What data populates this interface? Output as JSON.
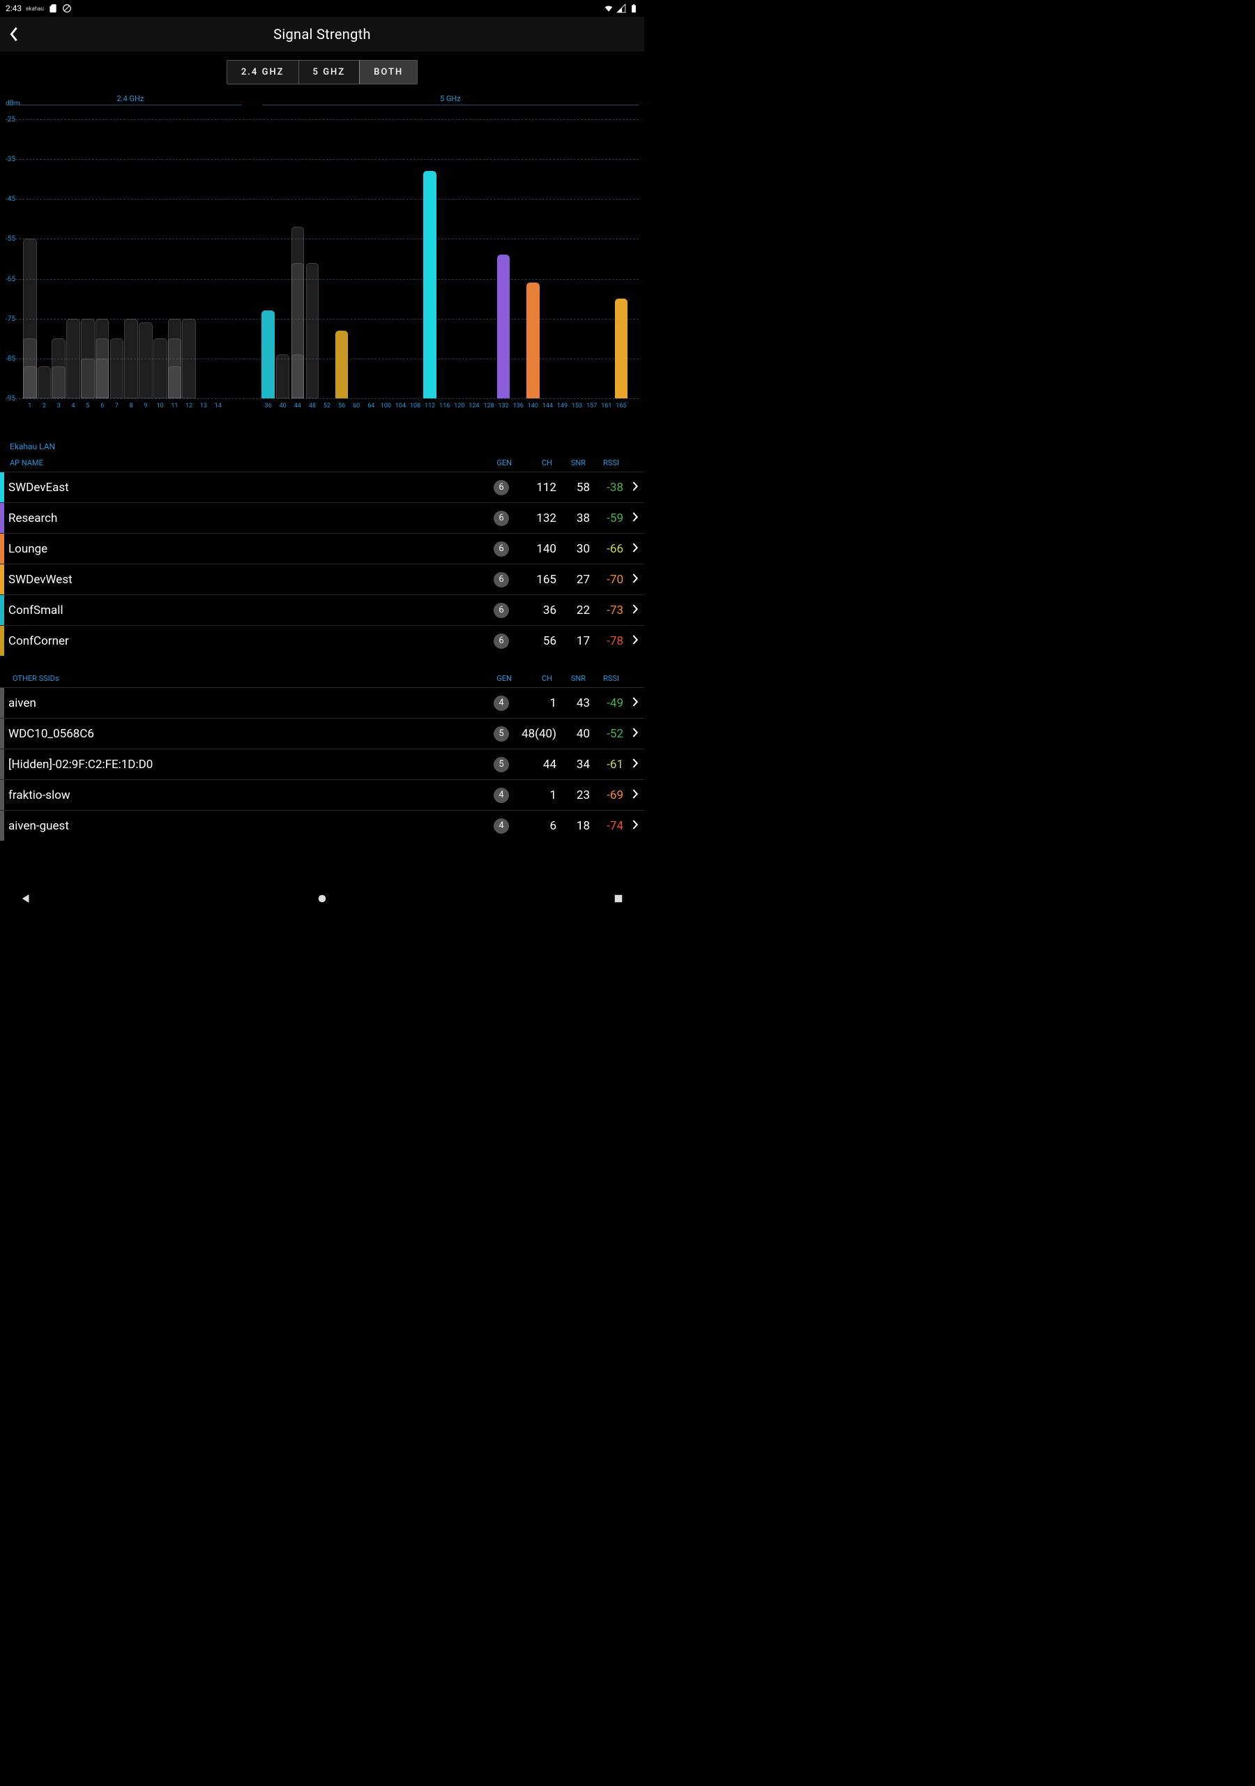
{
  "status": {
    "time": "2:43",
    "app_label": "ekahau"
  },
  "header": {
    "title": "Signal Strength"
  },
  "segments": {
    "a": "2.4 GHZ",
    "b": "5 GHZ",
    "c": "BOTH",
    "active": "c"
  },
  "chart_data": {
    "type": "bar",
    "ylabel": "dBm",
    "bands": {
      "a": "2.4 GHz",
      "b": "5 GHz"
    },
    "ylim": [
      -95,
      -25
    ],
    "yticks": [
      -25,
      -35,
      -45,
      -55,
      -65,
      -75,
      -85,
      -95
    ],
    "channels_24": [
      1,
      2,
      3,
      4,
      5,
      6,
      7,
      8,
      9,
      10,
      11,
      12,
      13,
      14
    ],
    "channels_5": [
      36,
      40,
      44,
      48,
      52,
      56,
      60,
      64,
      100,
      104,
      108,
      112,
      116,
      120,
      124,
      128,
      132,
      136,
      140,
      144,
      149,
      153,
      157,
      161,
      165
    ],
    "ghost_bars": [
      {
        "ch": 1,
        "v": -55,
        "band": "24"
      },
      {
        "ch": 1,
        "v": -80,
        "band": "24"
      },
      {
        "ch": 1,
        "v": -87,
        "band": "24"
      },
      {
        "ch": 2,
        "v": -87,
        "band": "24"
      },
      {
        "ch": 3,
        "v": -87,
        "band": "24"
      },
      {
        "ch": 3,
        "v": -80,
        "band": "24"
      },
      {
        "ch": 4,
        "v": -75,
        "band": "24"
      },
      {
        "ch": 5,
        "v": -75,
        "band": "24"
      },
      {
        "ch": 5,
        "v": -85,
        "band": "24"
      },
      {
        "ch": 6,
        "v": -75,
        "band": "24"
      },
      {
        "ch": 6,
        "v": -80,
        "band": "24"
      },
      {
        "ch": 6,
        "v": -85,
        "band": "24"
      },
      {
        "ch": 7,
        "v": -80,
        "band": "24"
      },
      {
        "ch": 8,
        "v": -75,
        "band": "24"
      },
      {
        "ch": 9,
        "v": -76,
        "band": "24"
      },
      {
        "ch": 10,
        "v": -80,
        "band": "24"
      },
      {
        "ch": 11,
        "v": -75,
        "band": "24"
      },
      {
        "ch": 11,
        "v": -80,
        "band": "24"
      },
      {
        "ch": 11,
        "v": -87,
        "band": "24"
      },
      {
        "ch": 12,
        "v": -75,
        "band": "24"
      },
      {
        "ch": 40,
        "v": -84,
        "band": "5"
      },
      {
        "ch": 44,
        "v": -52,
        "band": "5"
      },
      {
        "ch": 44,
        "v": -61,
        "band": "5"
      },
      {
        "ch": 44,
        "v": -84,
        "band": "5"
      },
      {
        "ch": 48,
        "v": -61,
        "band": "5"
      }
    ],
    "series": [
      {
        "name": "ConfSmall",
        "color": "#1fb8c9",
        "ch": 36,
        "v": -73,
        "band": "5"
      },
      {
        "name": "ConfCorner",
        "color": "#c99a1f",
        "ch": 56,
        "v": -78,
        "band": "5"
      },
      {
        "name": "SWDevEast",
        "color": "#1fd3e0",
        "ch": 112,
        "v": -38,
        "band": "5"
      },
      {
        "name": "Research",
        "color": "#8a5ed8",
        "ch": 132,
        "v": -59,
        "band": "5"
      },
      {
        "name": "Lounge",
        "color": "#e8803a",
        "ch": 140,
        "v": -66,
        "band": "5"
      },
      {
        "name": "SWDevWest",
        "color": "#e8a52a",
        "ch": 165,
        "v": -70,
        "band": "5"
      }
    ]
  },
  "ekahau_section": "Ekahau LAN",
  "headers": {
    "ap": "AP NAME",
    "gen": "GEN",
    "ch": "CH",
    "snr": "SNR",
    "rssi": "RSSI"
  },
  "rows_ekahau": [
    {
      "color": "#1fd3e0",
      "name": "SWDevEast",
      "gen": "6",
      "ch": "112",
      "snr": "58",
      "rssi": "-38",
      "rssi_class": "rssi-g"
    },
    {
      "color": "#8a5ed8",
      "name": "Research",
      "gen": "6",
      "ch": "132",
      "snr": "38",
      "rssi": "-59",
      "rssi_class": "rssi-g"
    },
    {
      "color": "#e8803a",
      "name": "Lounge",
      "gen": "6",
      "ch": "140",
      "snr": "30",
      "rssi": "-66",
      "rssi_class": "rssi-y"
    },
    {
      "color": "#e8a52a",
      "name": "SWDevWest",
      "gen": "6",
      "ch": "165",
      "snr": "27",
      "rssi": "-70",
      "rssi_class": "rssi-o"
    },
    {
      "color": "#1fb8c9",
      "name": "ConfSmall",
      "gen": "6",
      "ch": "36",
      "snr": "22",
      "rssi": "-73",
      "rssi_class": "rssi-o"
    },
    {
      "color": "#c99a1f",
      "name": "ConfCorner",
      "gen": "6",
      "ch": "56",
      "snr": "17",
      "rssi": "-78",
      "rssi_class": "rssi-r"
    }
  ],
  "other_section": "OTHER SSIDs",
  "rows_other": [
    {
      "color": "#555",
      "name": "aiven",
      "gen": "4",
      "ch": "1",
      "snr": "43",
      "rssi": "-49",
      "rssi_class": "rssi-g"
    },
    {
      "color": "#555",
      "name": "WDC10_0568C6",
      "gen": "5",
      "ch": "48(40)",
      "snr": "40",
      "rssi": "-52",
      "rssi_class": "rssi-g"
    },
    {
      "color": "#555",
      "name": "[Hidden]-02:9F:C2:FE:1D:D0",
      "gen": "5",
      "ch": "44",
      "snr": "34",
      "rssi": "-61",
      "rssi_class": "rssi-y"
    },
    {
      "color": "#555",
      "name": "fraktio-slow",
      "gen": "4",
      "ch": "1",
      "snr": "23",
      "rssi": "-69",
      "rssi_class": "rssi-o"
    },
    {
      "color": "#555",
      "name": "aiven-guest",
      "gen": "4",
      "ch": "6",
      "snr": "18",
      "rssi": "-74",
      "rssi_class": "rssi-r"
    }
  ]
}
